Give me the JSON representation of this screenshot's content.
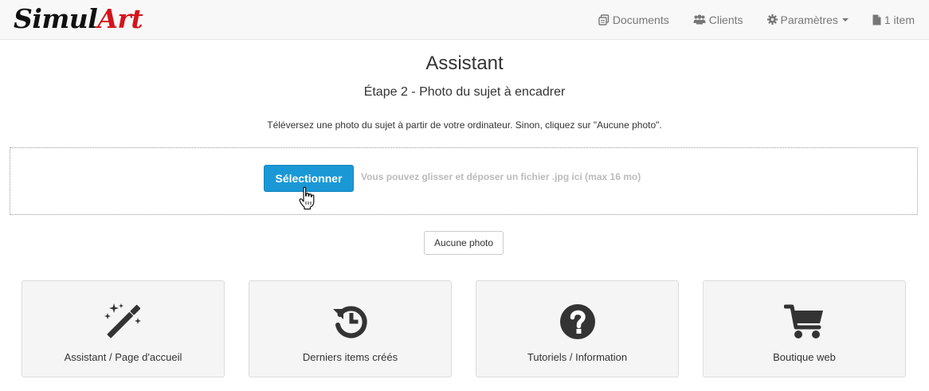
{
  "brand": {
    "part1": "Simul",
    "part2": "Art",
    "accent_color": "#d4141a"
  },
  "nav": {
    "items": [
      {
        "label": "Documents",
        "icon": "documents-icon"
      },
      {
        "label": "Clients",
        "icon": "users-icon"
      },
      {
        "label": "Paramètres",
        "icon": "gear-icon",
        "has_dropdown": true
      },
      {
        "label": "1 item",
        "icon": "file-icon"
      }
    ]
  },
  "main": {
    "title": "Assistant",
    "subtitle": "Étape 2 - Photo du sujet à encadrer",
    "instructions": "Téléversez une photo du sujet à partir de votre ordinateur. Sinon, cliquez sur \"Aucune photo\"."
  },
  "dropzone": {
    "select_label": "Sélectionner",
    "hint": "Vous pouvez glisser et déposer un fichier .jpg ici (max 16 mo)",
    "button_color": "#1a98d5"
  },
  "no_photo_label": "Aucune photo",
  "tiles": [
    {
      "label": "Assistant / Page d'accueil",
      "icon": "magic-wand-icon"
    },
    {
      "label": "Derniers items créés",
      "icon": "history-icon"
    },
    {
      "label": "Tutoriels / Information",
      "icon": "question-circle-icon"
    },
    {
      "label": "Boutique web",
      "icon": "shopping-cart-icon"
    }
  ]
}
